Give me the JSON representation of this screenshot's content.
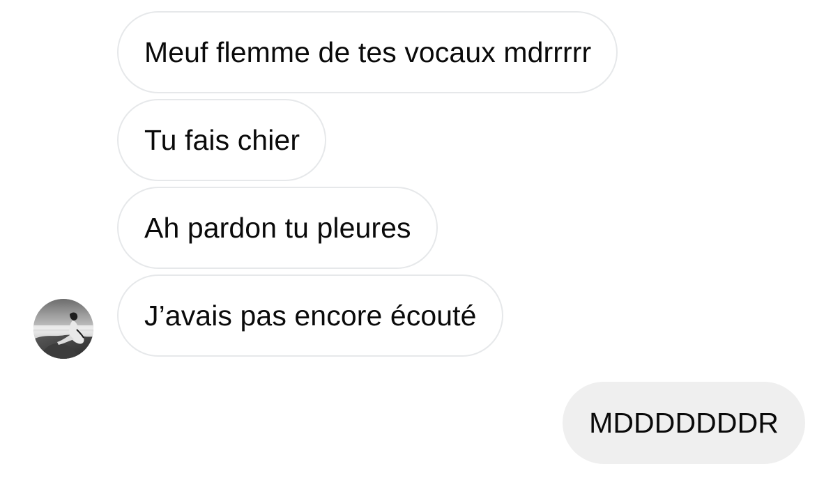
{
  "conversation": {
    "messages": [
      {
        "sender": "contact",
        "text": "Meuf flemme de tes vocaux mdrrrrr"
      },
      {
        "sender": "contact",
        "text": "Tu fais chier"
      },
      {
        "sender": "contact",
        "text": "Ah pardon tu pleures"
      },
      {
        "sender": "contact",
        "text": "J’avais pas encore écouté"
      },
      {
        "sender": "me",
        "text": "MDDDDDDDR"
      }
    ],
    "contact": {
      "avatar_icon": "profile-photo-avatar"
    }
  },
  "colors": {
    "background": "#ffffff",
    "received_bubble_border": "#e6e8ea",
    "sent_bubble_fill": "#efefef",
    "text": "#0a0a0a"
  }
}
